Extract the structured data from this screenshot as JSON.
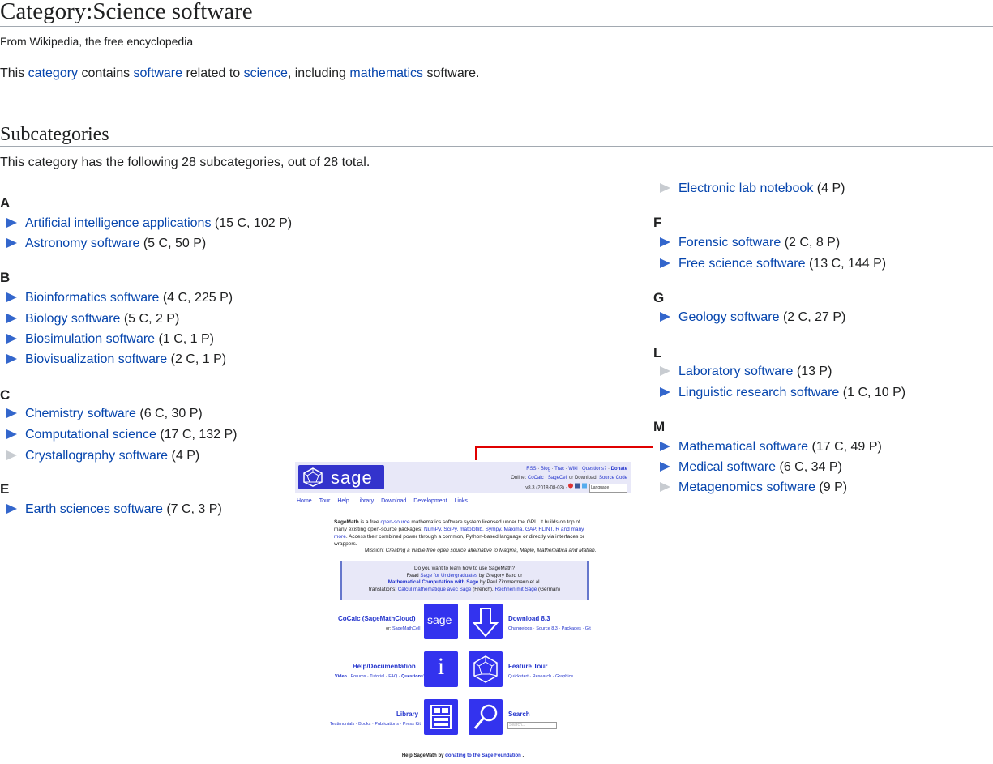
{
  "page": {
    "title": "Category:Science software",
    "tagline": "From Wikipedia, the free encyclopedia",
    "intro": {
      "t1": "This ",
      "l1": "category",
      "t2": " contains ",
      "l2": "software",
      "t3": " related to ",
      "l3": "science",
      "t4": ", including ",
      "l4": "mathematics",
      "t5": " software."
    },
    "subcategories_heading": "Subcategories",
    "subcategories_count": "This category has the following 28 subcategories, out of 28 total."
  },
  "groups": [
    {
      "letter": "A",
      "items": [
        {
          "label": "Artificial intelligence applications",
          "count": "(15 C, 102 P)",
          "empty": false
        },
        {
          "label": "Astronomy software",
          "count": "(5 C, 50 P)",
          "empty": false
        }
      ]
    },
    {
      "letter": "B",
      "items": [
        {
          "label": "Bioinformatics software",
          "count": "(4 C, 225 P)",
          "empty": false
        },
        {
          "label": "Biology software",
          "count": "(5 C, 2 P)",
          "empty": false
        },
        {
          "label": "Biosimulation software",
          "count": "(1 C, 1 P)",
          "empty": false
        },
        {
          "label": "Biovisualization software",
          "count": "(2 C, 1 P)",
          "empty": false
        }
      ]
    },
    {
      "letter": "C",
      "items": [
        {
          "label": "Chemistry software",
          "count": "(6 C, 30 P)",
          "empty": false
        },
        {
          "label": "Computational science",
          "count": "(17 C, 132 P)",
          "empty": false
        },
        {
          "label": "Crystallography software",
          "count": "(4 P)",
          "empty": true
        }
      ]
    },
    {
      "letter": "E",
      "items": [
        {
          "label": "Earth sciences software",
          "count": "(7 C, 3 P)",
          "empty": false
        },
        {
          "label": "Electronic lab notebook",
          "count": "(4 P)",
          "empty": true
        }
      ]
    },
    {
      "letter": "F",
      "items": [
        {
          "label": "Forensic software",
          "count": "(2 C, 8 P)",
          "empty": false
        },
        {
          "label": "Free science software",
          "count": "(13 C, 144 P)",
          "empty": false
        }
      ]
    },
    {
      "letter": "G",
      "items": [
        {
          "label": "Geology software",
          "count": "(2 C, 27 P)",
          "empty": false
        }
      ]
    },
    {
      "letter": "L",
      "items": [
        {
          "label": "Laboratory software",
          "count": "(13 P)",
          "empty": true
        },
        {
          "label": "Linguistic research software",
          "count": "(1 C, 10 P)",
          "empty": false
        }
      ]
    },
    {
      "letter": "M",
      "items": [
        {
          "label": "Mathematical software",
          "count": "(17 C, 49 P)",
          "empty": false
        },
        {
          "label": "Medical software",
          "count": "(6 C, 34 P)",
          "empty": false
        },
        {
          "label": "Metagenomics software",
          "count": "(9 P)",
          "empty": true
        }
      ]
    }
  ],
  "colors": {
    "link": "#0645ad",
    "arrow": "#3366cc",
    "arrow_empty": "#c8ccd1",
    "callout": "#e00000",
    "sage_blue": "#3333ee"
  },
  "sage": {
    "logo_text": "sage",
    "top_links": {
      "rss": "RSS",
      "blog": "Blog",
      "trac": "Trac",
      "wiki": "Wiki",
      "questions": "Questions?",
      "donate": "Donate"
    },
    "online_prefix": "Online: ",
    "online_cocalc": "CoCalc",
    "online_sep": " · ",
    "online_sagecell": "SageCell",
    "online_or": " or Download, ",
    "online_source": "Source Code",
    "version": "v8.3 (2018-08-03) ·",
    "language_select": "Language",
    "nav": [
      "Home",
      "Tour",
      "Help",
      "Library",
      "Download",
      "Development",
      "Links"
    ],
    "desc": {
      "name": "SageMath",
      "t1": " is a free ",
      "l1": "open-source",
      "t2": " mathematics software system licensed under the GPL. It builds on top of many existing open-source packages: ",
      "l2": "NumPy, SciPy, matplotlib, Sympy, Maxima, GAP, FLINT, R and many more",
      "t3": ". Access their combined power through a common, Python-based language or directly via interfaces or wrappers."
    },
    "mission_label": "Mission: ",
    "mission_text": "Creating a viable free open source alternative to Magma, Maple, Mathematica and Matlab.",
    "box": {
      "line1": "Do you want to learn how to use SageMath?",
      "read": "Read ",
      "book1": "Sage for Undergraduates",
      "by1": " by Gregory Bard or",
      "book2": "Mathematical Computation with Sage",
      "by2": " by Paul Zimmermann et al.",
      "trans": "translations: ",
      "book3": "Calcul mathématique avec Sage",
      "fr": " (French), ",
      "book4": "Rechnen mit Sage",
      "de": " (German)"
    },
    "tiles": {
      "cocalc_title": "CoCalc (SageMathCloud)",
      "cocalc_sub_or": "or: ",
      "cocalc_sub": "SageMathCell",
      "cocalc_icon_text": "sage",
      "download_title": "Download 8.3",
      "download_sub": "Changelogs · Source 8.3 · Packages · Git",
      "help_title": "Help/Documentation",
      "help_sub_video": "Video",
      "help_sub_rest": " · Forums · Tutorial · FAQ · ",
      "help_sub_q": "Questions?",
      "help_icon_text": "i",
      "tour_title": "Feature Tour",
      "tour_sub": "Quickstart · Research · Graphics",
      "library_title": "Library",
      "library_sub": "Testimonials · Books · Publications · Press Kit",
      "search_title": "Search",
      "search_placeholder": "Search..."
    },
    "footer_t1": "Help SageMath by ",
    "footer_link": "donating to the Sage Foundation",
    "footer_t2": " ."
  }
}
